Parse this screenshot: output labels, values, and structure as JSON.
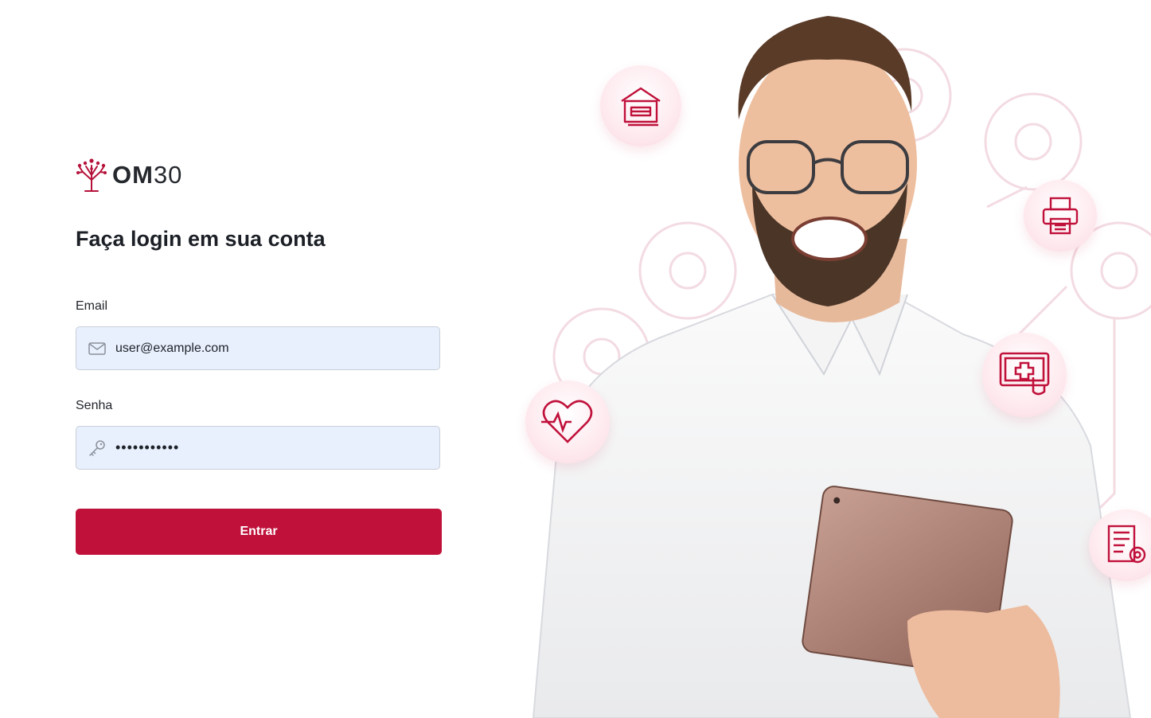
{
  "brand": {
    "logo_bold": "OM",
    "logo_light": "30",
    "accent_color": "#c0113b"
  },
  "login": {
    "title": "Faça login em sua conta",
    "email_label": "Email",
    "email_value": "user@example.com",
    "password_label": "Senha",
    "password_value": "•••••••••••",
    "submit_label": "Entrar"
  },
  "hero": {
    "icons": [
      "school-icon",
      "printer-icon",
      "heart-rate-icon",
      "tablet-health-icon",
      "document-settings-icon"
    ]
  }
}
